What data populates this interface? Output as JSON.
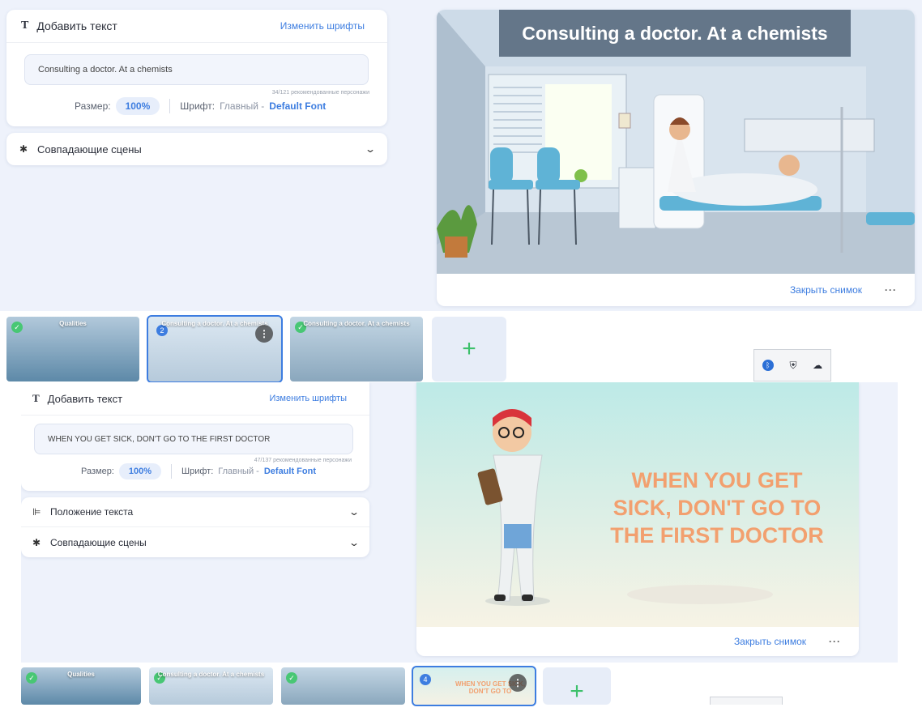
{
  "screen1": {
    "text_panel": {
      "title": "Добавить текст",
      "title_icon": "T",
      "change_fonts": "Изменить шрифты",
      "text_value": "Consulting a doctor. At a chemists",
      "counter": "34/121 рекомендованные персонажи",
      "size_label": "Размер:",
      "size_value": "100%",
      "font_label": "Шрифт:",
      "font_type": "Главный -",
      "font_name": "Default Font"
    },
    "matching_scenes": "Совпадающие сцены",
    "preview": {
      "banner": "Consulting a doctor. At a chemists",
      "close_shot": "Закрыть снимок",
      "more": "···"
    },
    "thumbnails": [
      {
        "caption": "Qualities",
        "badge": "✓"
      },
      {
        "caption": "Consulting a doctor. At a chemists",
        "badge": "2"
      },
      {
        "caption": "Consulting a doctor. At a chemists",
        "badge": "✓"
      }
    ],
    "add": "+"
  },
  "tray": {
    "icons": [
      "bluetooth-icon",
      "shield-icon",
      "cloud-icon"
    ]
  },
  "screen2": {
    "text_panel": {
      "title": "Добавить текст",
      "title_icon": "T",
      "change_fonts": "Изменить шрифты",
      "text_value": "WHEN YOU GET SICK, DON'T GO TO THE FIRST DOCTOR",
      "counter": "47/137 рекомендованные персонажи",
      "size_label": "Размер:",
      "size_value": "100%",
      "font_label": "Шрифт:",
      "font_type": "Главный -",
      "font_name": "Default Font"
    },
    "text_position": "Положение текста",
    "matching_scenes": "Совпадающие сцены",
    "preview": {
      "headline": [
        "WHEN YOU GET",
        "SICK, DON'T GO TO",
        "THE FIRST DOCTOR"
      ],
      "close_shot": "Закрыть снимок",
      "more": "···"
    },
    "thumbnails": [
      {
        "caption": "Qualities",
        "badge": "✓"
      },
      {
        "caption": "Consulting a doctor. At a chemists",
        "badge": "✓"
      },
      {
        "caption": "",
        "badge": "✓"
      },
      {
        "caption": "WHEN YOU GET SICK, DON'T GO TO",
        "badge": "4"
      }
    ],
    "add": "+"
  },
  "colors": {
    "accent": "#3d7de0",
    "headline": "#f2a06f",
    "check": "#48c774"
  }
}
